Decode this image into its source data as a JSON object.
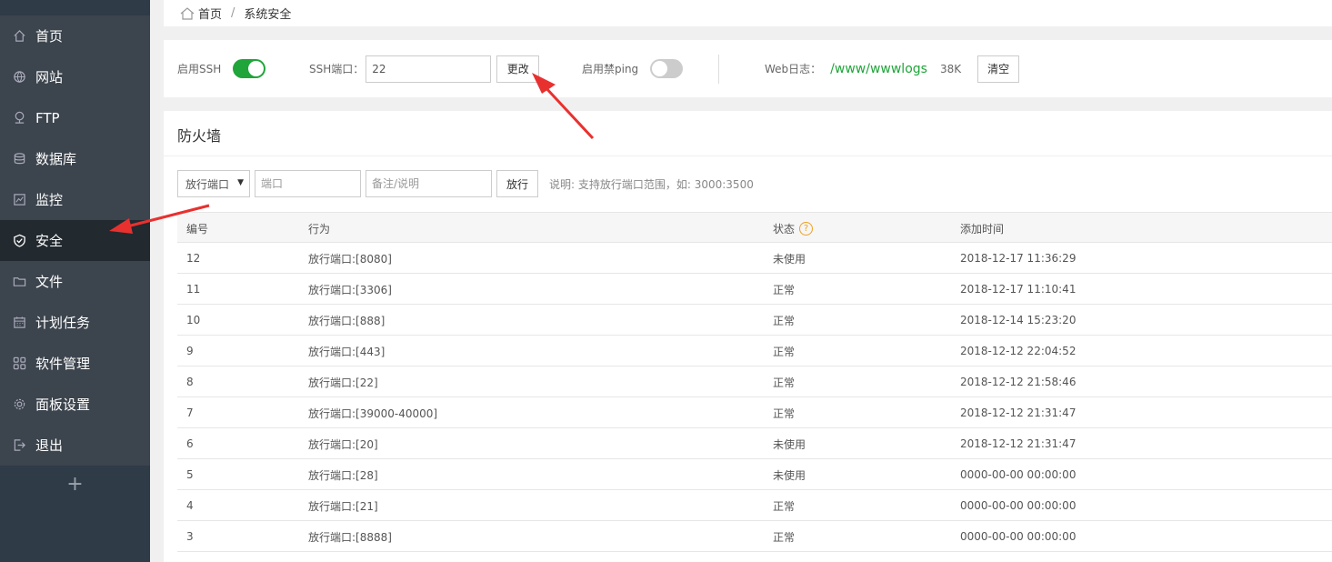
{
  "breadcrumb": {
    "home": "首页",
    "current": "系统安全"
  },
  "sidebar": {
    "items": [
      {
        "label": "首页",
        "icon": "home-icon"
      },
      {
        "label": "网站",
        "icon": "globe-icon"
      },
      {
        "label": "FTP",
        "icon": "network-icon"
      },
      {
        "label": "数据库",
        "icon": "database-icon"
      },
      {
        "label": "监控",
        "icon": "monitor-icon"
      },
      {
        "label": "安全",
        "icon": "shield-icon",
        "active": true
      },
      {
        "label": "文件",
        "icon": "folder-icon"
      },
      {
        "label": "计划任务",
        "icon": "calendar-icon"
      },
      {
        "label": "软件管理",
        "icon": "grid-icon"
      },
      {
        "label": "面板设置",
        "icon": "gear-icon"
      },
      {
        "label": "退出",
        "icon": "logout-icon"
      }
    ],
    "add": "+"
  },
  "settings": {
    "ssh_label": "启用SSH",
    "ssh_enabled": true,
    "ssh_port_label": "SSH端口：",
    "ssh_port_value": "22",
    "change_button": "更改",
    "ping_label": "启用禁ping",
    "ping_enabled": false,
    "weblog_label": "Web日志：",
    "weblog_path": "/www/wwwlogs",
    "weblog_size": "38K",
    "clear_button": "清空"
  },
  "firewall": {
    "title": "防火墙",
    "select_value": "放行端口",
    "port_placeholder": "端口",
    "note_placeholder": "备注/说明",
    "allow_button": "放行",
    "hint": "说明: 支持放行端口范围，如: 3000:3500",
    "columns": [
      "编号",
      "行为",
      "状态",
      "添加时间"
    ],
    "status_help": "?",
    "rows": [
      {
        "id": "12",
        "action": "放行端口:[8080]",
        "status": "未使用",
        "time": "2018-12-17 11:36:29"
      },
      {
        "id": "11",
        "action": "放行端口:[3306]",
        "status": "正常",
        "time": "2018-12-17 11:10:41"
      },
      {
        "id": "10",
        "action": "放行端口:[888]",
        "status": "正常",
        "time": "2018-12-14 15:23:20"
      },
      {
        "id": "9",
        "action": "放行端口:[443]",
        "status": "正常",
        "time": "2018-12-12 22:04:52"
      },
      {
        "id": "8",
        "action": "放行端口:[22]",
        "status": "正常",
        "time": "2018-12-12 21:58:46"
      },
      {
        "id": "7",
        "action": "放行端口:[39000-40000]",
        "status": "正常",
        "time": "2018-12-12 21:31:47"
      },
      {
        "id": "6",
        "action": "放行端口:[20]",
        "status": "未使用",
        "time": "2018-12-12 21:31:47"
      },
      {
        "id": "5",
        "action": "放行端口:[28]",
        "status": "未使用",
        "time": "0000-00-00 00:00:00"
      },
      {
        "id": "4",
        "action": "放行端口:[21]",
        "status": "正常",
        "time": "0000-00-00 00:00:00"
      },
      {
        "id": "3",
        "action": "放行端口:[8888]",
        "status": "正常",
        "time": "0000-00-00 00:00:00"
      }
    ]
  },
  "colors": {
    "accent": "#20a53a",
    "sidebar_bg": "#3c444d",
    "sidebar_active": "#22292f",
    "annotation": "#e8312f"
  }
}
